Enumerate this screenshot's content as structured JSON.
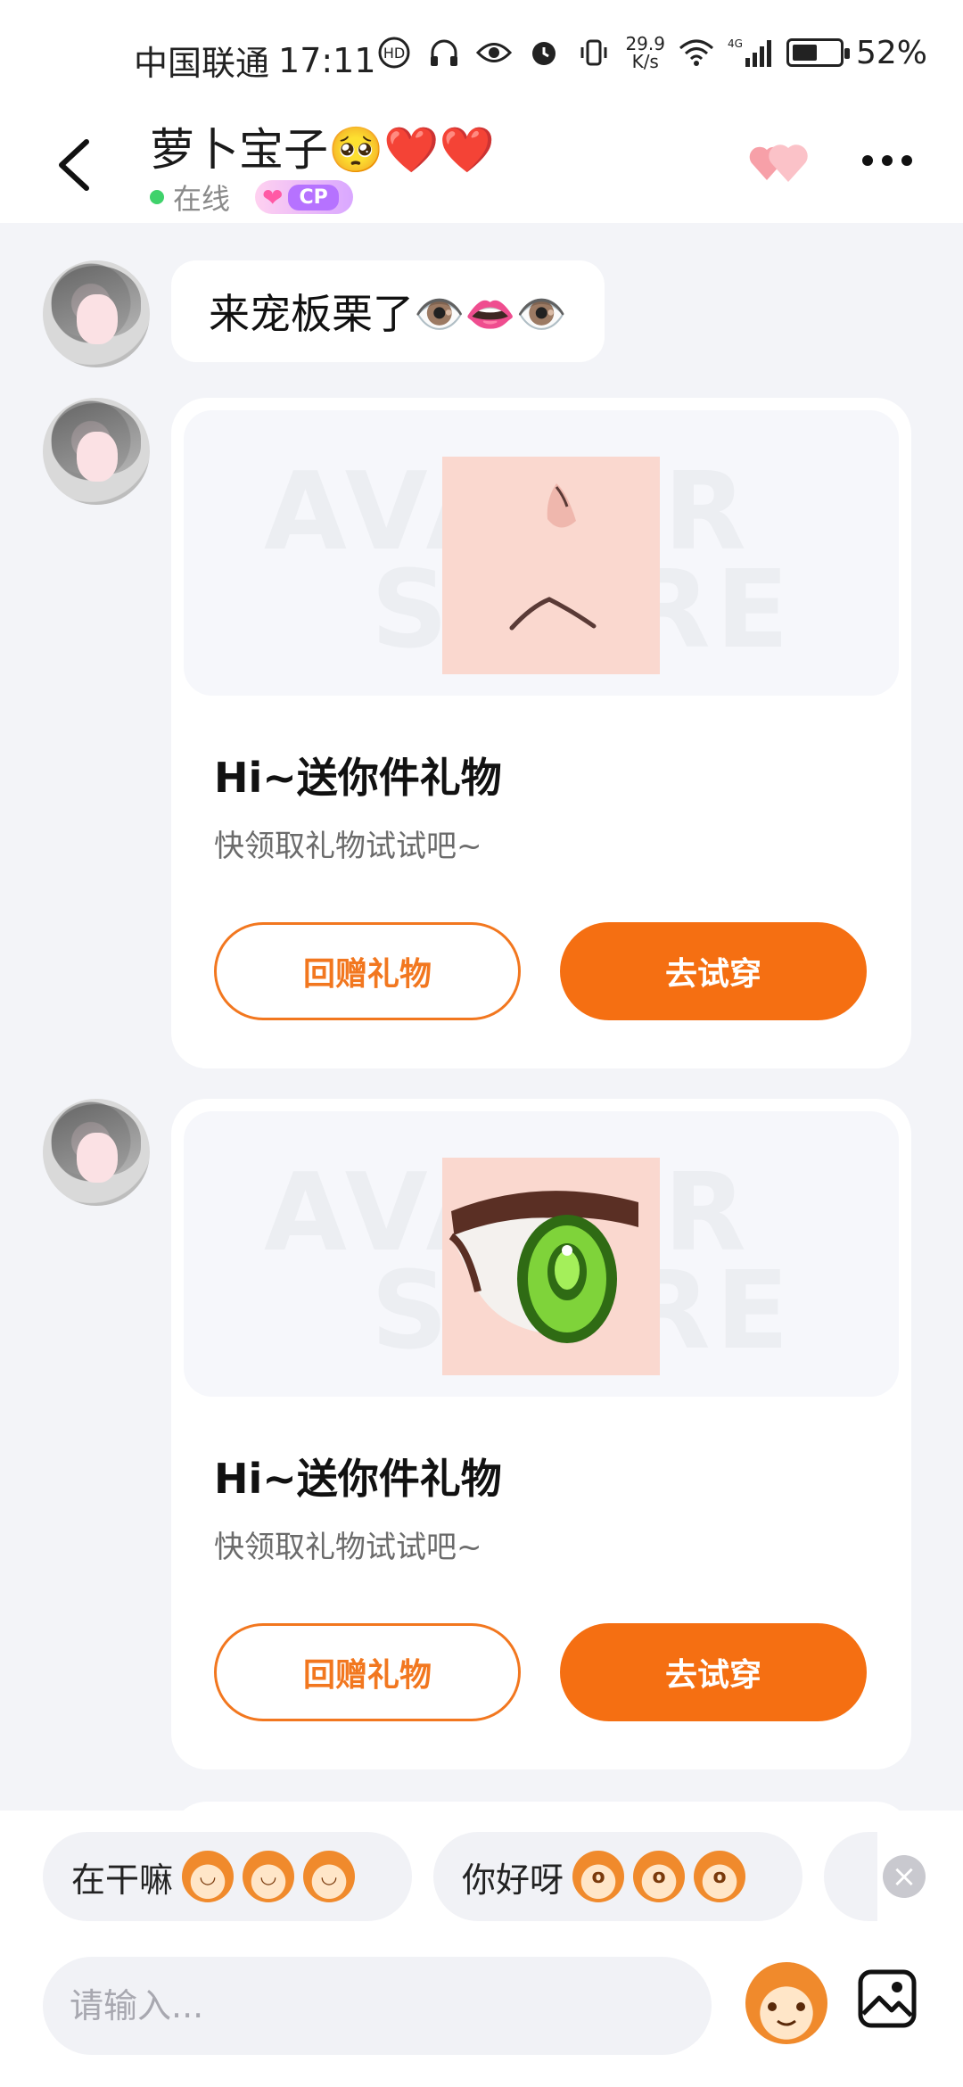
{
  "status_bar": {
    "carrier": "中国联通",
    "time": "17:11",
    "net_speed_value": "29.9",
    "net_speed_unit": "K/s",
    "signal_label": "4G",
    "battery_percent": "52%",
    "battery_level": 0.52
  },
  "header": {
    "title": "萝卜宝子🥺❤️❤️",
    "status": "在线",
    "badge": "CP"
  },
  "messages": {
    "text_message": "来宠板栗了👁️👄👁️",
    "gift_cards": [
      {
        "title": "Hi~送你件礼物",
        "desc": "快领取礼物试试吧~",
        "return_label": "回赠礼物",
        "try_label": "去试穿",
        "watermark_line1": "AVATAR",
        "watermark_line2": "STORE"
      },
      {
        "title": "Hi~送你件礼物",
        "desc": "快领取礼物试试吧~",
        "return_label": "回赠礼物",
        "try_label": "去试穿",
        "watermark_line1": "AVATAR",
        "watermark_line2": "STORE"
      }
    ]
  },
  "quick_replies": [
    {
      "text": "在干嘛"
    },
    {
      "text": "你好呀"
    }
  ],
  "input": {
    "placeholder": "请输入..."
  },
  "colors": {
    "accent": "#f56f12",
    "online": "#3fd26b",
    "background": "#f3f4f8"
  }
}
